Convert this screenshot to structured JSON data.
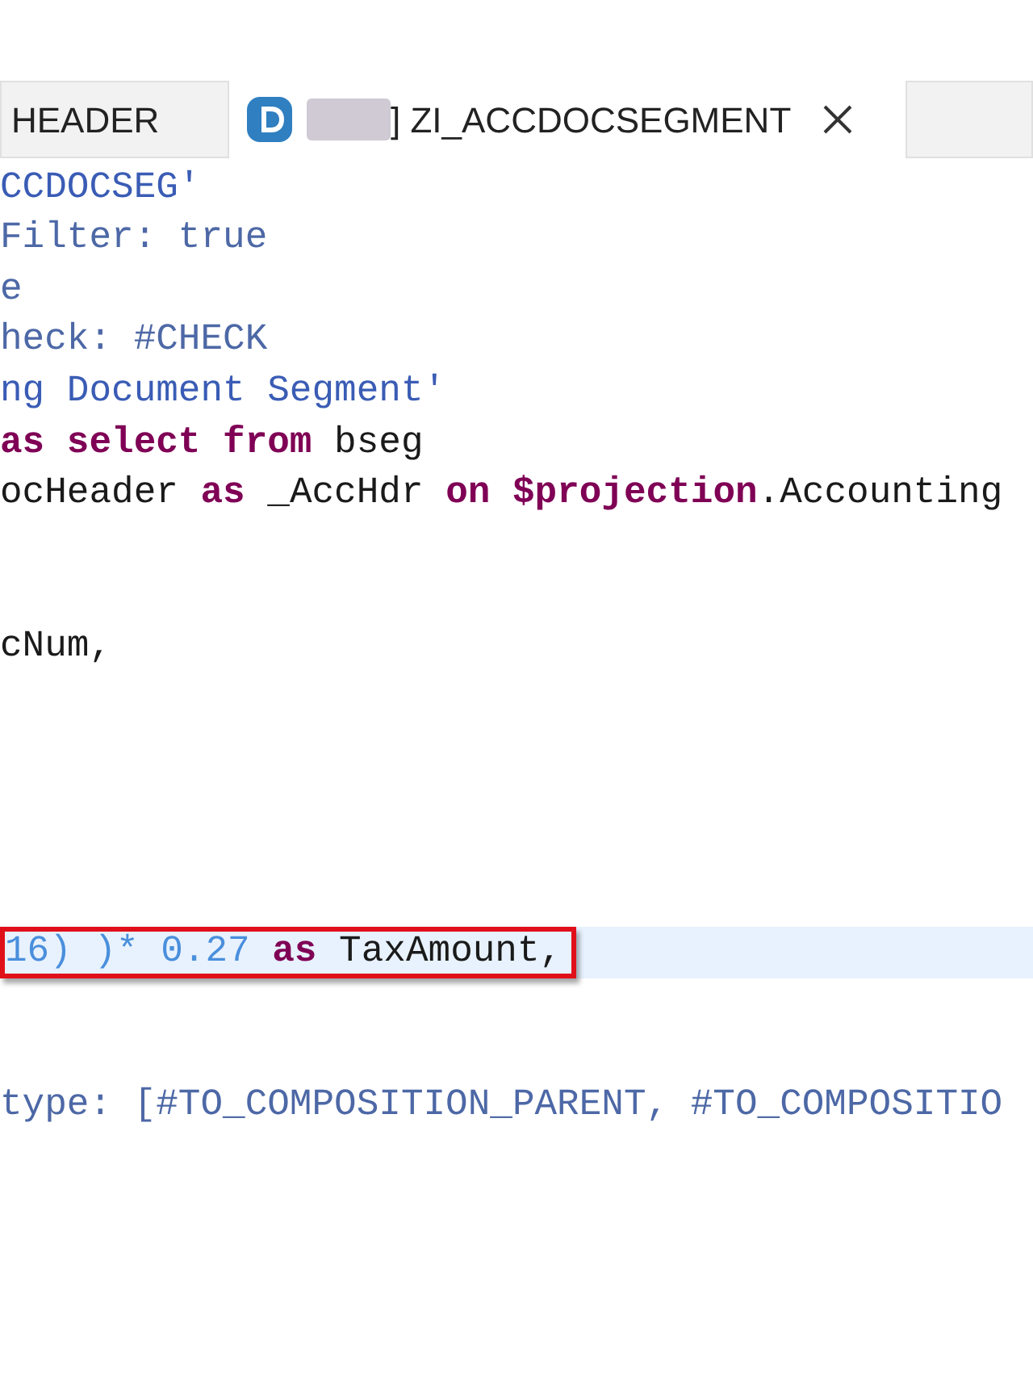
{
  "tabs": [
    {
      "label": "HEADER",
      "selected": false,
      "kind": "plain"
    },
    {
      "label": "] ZI_ACCDOCSEGMENT",
      "selected": true,
      "kind": "document",
      "closable": true
    },
    {
      "selected": false,
      "kind": "plain"
    }
  ],
  "code_lines": [
    {
      "kind": "code",
      "tokens": [
        {
          "text": "CCDOCSEG'",
          "kind": "string"
        }
      ]
    },
    {
      "kind": "code",
      "tokens": [
        {
          "text": "Filter: true",
          "kind": "annotation"
        }
      ]
    },
    {
      "kind": "code",
      "tokens": [
        {
          "text": "e",
          "kind": "annotation"
        }
      ]
    },
    {
      "kind": "code",
      "tokens": [
        {
          "text": "heck: #CHECK",
          "kind": "annotation"
        }
      ]
    },
    {
      "kind": "code",
      "tokens": [
        {
          "text": "ng Document Segment'",
          "kind": "string"
        }
      ]
    },
    {
      "kind": "code",
      "tokens": [
        {
          "text": "as select from",
          "kind": "keyword"
        },
        {
          "text": " bseg",
          "kind": "plain"
        }
      ]
    },
    {
      "kind": "code",
      "tokens": [
        {
          "text": "ocHeader",
          "kind": "plain"
        },
        {
          "text": " as",
          "kind": "keyword"
        },
        {
          "text": " _AccHdr",
          "kind": "plain"
        },
        {
          "text": " on $projection",
          "kind": "keyword"
        },
        {
          "text": ".Accounting",
          "kind": "plain"
        }
      ]
    },
    {
      "kind": "blank"
    },
    {
      "kind": "blank"
    },
    {
      "kind": "code",
      "tokens": [
        {
          "text": "cNum,",
          "kind": "plain"
        }
      ]
    },
    {
      "kind": "blank"
    },
    {
      "kind": "blank"
    },
    {
      "kind": "blank"
    },
    {
      "kind": "blank"
    },
    {
      "kind": "blank"
    },
    {
      "kind": "code",
      "current": true,
      "boxed": true,
      "tokens": [
        {
          "text": "16) )* 0.27",
          "kind": "number"
        },
        {
          "text": " as",
          "kind": "keyword"
        },
        {
          "text": " TaxAmount,",
          "kind": "plain"
        }
      ]
    },
    {
      "kind": "blank"
    },
    {
      "kind": "blank"
    },
    {
      "kind": "code",
      "tokens": [
        {
          "text": "type: [#TO_COMPOSITION_PARENT, #TO_COMPOSITIO",
          "kind": "annotation"
        }
      ]
    }
  ]
}
